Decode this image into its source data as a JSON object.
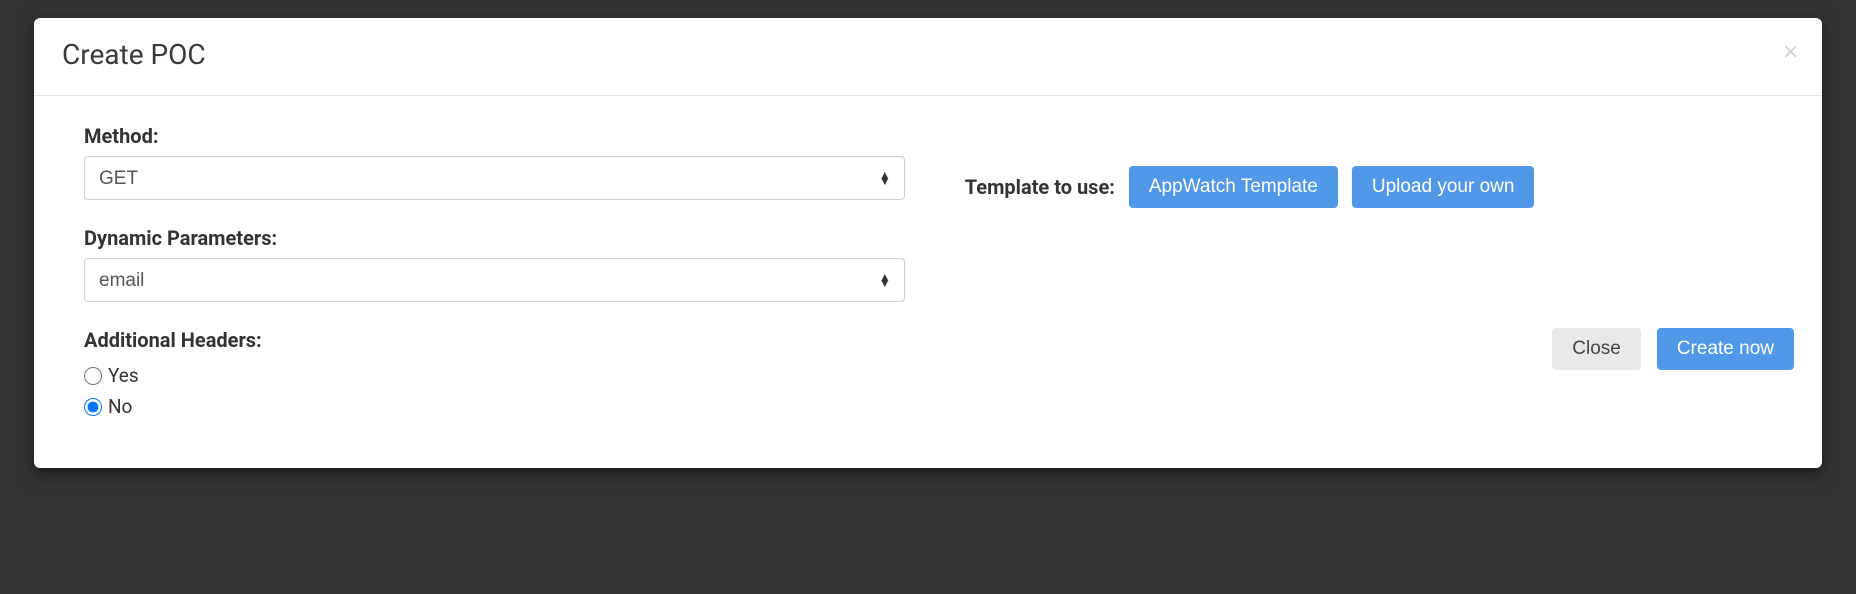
{
  "modal": {
    "title": "Create POC",
    "close_aria": "Close",
    "form": {
      "method_label": "Method:",
      "method_value": "GET",
      "dynamic_params_label": "Dynamic Parameters:",
      "dynamic_params_value": "email",
      "additional_headers_label": "Additional Headers:",
      "headers_yes": "Yes",
      "headers_no": "No",
      "headers_selected": "No"
    },
    "template": {
      "label": "Template to use:",
      "appwatch_btn": "AppWatch Template",
      "upload_btn": "Upload your own"
    },
    "footer": {
      "close_btn": "Close",
      "create_btn": "Create now"
    }
  }
}
